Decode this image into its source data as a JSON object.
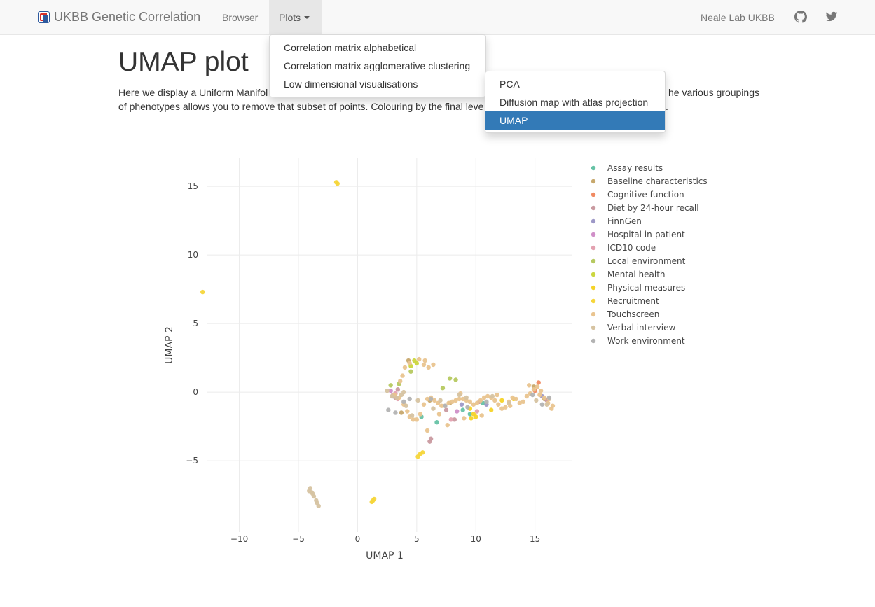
{
  "navbar": {
    "brand": "UKBB Genetic Correlation",
    "browser": "Browser",
    "plots": "Plots",
    "lab": "Neale Lab UKBB"
  },
  "icons": {
    "github": "github-icon",
    "twitter": "twitter-icon"
  },
  "plots_menu": {
    "items": [
      "Correlation matrix alphabetical",
      "Correlation matrix agglomerative clustering",
      "Low dimensional visualisations"
    ]
  },
  "submenu": {
    "items": [
      "PCA",
      "Diffusion map with atlas projection",
      "UMAP"
    ],
    "selected": "UMAP"
  },
  "page": {
    "title": "UMAP plot",
    "intro_line1_start": "Here we display a Uniform Manifol",
    "intro_line1_end": "he various groupings",
    "intro_line2_start": "of phenotypes allows you to remove that subset of points. Colouring by the final leve",
    "intro_line2_end": "."
  },
  "colors": {
    "accent": "#337ab7",
    "navbar_bg": "#f8f8f8"
  },
  "chart_data": {
    "type": "scatter",
    "xlabel": "UMAP 1",
    "ylabel": "UMAP 2",
    "xlim": [
      -12.7,
      18.1
    ],
    "ylim": [
      -10.2,
      17.1
    ],
    "xticks": [
      -10,
      -5,
      0,
      5,
      10,
      15
    ],
    "yticks": [
      -5,
      0,
      5,
      10,
      15
    ],
    "xtick_labels": [
      "−10",
      "−5",
      "0",
      "5",
      "10",
      "15"
    ],
    "ytick_labels": [
      "−5",
      "0",
      "5",
      "10",
      "15"
    ],
    "grid": true,
    "legend_position": "right",
    "series": [
      {
        "name": "Assay results",
        "color": "#66c2a5",
        "x": [
          5.4,
          6.7,
          8.9,
          9.5,
          10.6
        ],
        "y": [
          -1.8,
          -2.2,
          -1.3,
          -1.6,
          -0.8
        ]
      },
      {
        "name": "Baseline characteristics",
        "color": "#c7a86d",
        "x": [
          3.7,
          4.3,
          6.1,
          7.8,
          14.9,
          15.8
        ],
        "y": [
          -1.5,
          2.3,
          -0.6,
          -0.8,
          0.4,
          -0.5
        ]
      },
      {
        "name": "Cognitive function",
        "color": "#f08a62",
        "x": [
          15.3,
          15.0
        ],
        "y": [
          0.7,
          0.1
        ]
      },
      {
        "name": "Diet by 24-hour recall",
        "color": "#c99aa0",
        "x": [
          3.2,
          3.4,
          7.5,
          8.2,
          10.3,
          16.0,
          6.1,
          6.2
        ],
        "y": [
          -0.4,
          0.2,
          -1.3,
          -2.0,
          -0.7,
          -0.6,
          -3.6,
          -3.4
        ]
      },
      {
        "name": "FinnGen",
        "color": "#9d98c7",
        "x": [
          3.0,
          8.8,
          10.9,
          15.6
        ],
        "y": [
          -0.3,
          -0.9,
          -0.9,
          -0.3
        ]
      },
      {
        "name": "Hospital in-patient",
        "color": "#d08fc8",
        "x": [
          3.0,
          2.8,
          8.4
        ],
        "y": [
          -0.2,
          0.1,
          -1.4
        ]
      },
      {
        "name": "ICD10 code",
        "color": "#e3a1b0",
        "x": [
          3.4,
          3.2,
          7.9,
          10.1
        ],
        "y": [
          -0.5,
          -0.1,
          -2.0,
          -1.4
        ]
      },
      {
        "name": "Local environment",
        "color": "#b6c960",
        "x": [
          7.2,
          7.8,
          8.3,
          2.8,
          3.5,
          4.5
        ],
        "y": [
          0.3,
          1.0,
          0.9,
          0.5,
          0.6,
          1.5
        ]
      },
      {
        "name": "Mental health",
        "color": "#cbd63f",
        "x": [
          4.5,
          5.0,
          4.8
        ],
        "y": [
          1.9,
          2.1,
          2.3
        ]
      },
      {
        "name": "Physical measures",
        "color": "#f5d328",
        "x": [
          9.8,
          9.6,
          10.0,
          12.2,
          13.2,
          9.5,
          11.3
        ],
        "y": [
          -1.6,
          -1.9,
          -1.8,
          -0.6,
          -0.5,
          -1.2,
          -1.3
        ]
      },
      {
        "name": "Recruitment",
        "color": "#f6d63b",
        "x": [
          -1.8,
          -1.7,
          -13.1,
          5.1,
          5.3,
          5.5,
          1.2,
          1.3,
          1.4
        ],
        "y": [
          15.3,
          15.2,
          7.3,
          -4.7,
          -4.5,
          -4.4,
          -8.0,
          -7.9,
          -7.8
        ]
      },
      {
        "name": "Touchscreen",
        "color": "#e9c48f",
        "x": [
          3.1,
          3.5,
          3.9,
          4.2,
          4.4,
          4.7,
          5.0,
          5.3,
          5.6,
          5.9,
          6.2,
          6.5,
          6.8,
          7.1,
          7.4,
          7.7,
          8.0,
          8.3,
          8.6,
          8.9,
          9.2,
          9.5,
          9.8,
          10.1,
          10.4,
          10.7,
          11.0,
          11.3,
          11.6,
          11.9,
          12.2,
          12.5,
          12.8,
          13.1,
          13.4,
          13.7,
          14.0,
          14.3,
          14.6,
          14.9,
          15.2,
          15.5,
          15.8,
          16.1,
          16.4,
          3.8,
          4.0,
          4.4,
          5.2,
          5.6,
          6.0,
          6.4,
          5.7,
          6.9,
          7.6,
          9.0,
          10.5,
          11.8,
          12.9,
          14.5,
          15.4,
          16.2,
          16.5,
          3.6,
          5.9,
          8.7
        ],
        "y": [
          -0.2,
          -0.4,
          -0.9,
          -1.4,
          -1.8,
          -2.0,
          -2.0,
          -1.6,
          -0.9,
          -0.5,
          -0.4,
          -0.6,
          -0.8,
          -1.0,
          -1.0,
          -0.8,
          -0.7,
          -0.6,
          -0.5,
          -0.5,
          -0.6,
          -0.7,
          -0.9,
          -0.8,
          -0.6,
          -0.4,
          -0.3,
          -0.4,
          -0.6,
          -0.9,
          -1.2,
          -1.1,
          -0.7,
          -0.4,
          -0.5,
          -0.8,
          -0.7,
          -0.3,
          -0.1,
          0.2,
          0.4,
          0.1,
          -0.4,
          -0.8,
          -1.2,
          1.2,
          1.8,
          2.1,
          2.4,
          2.0,
          1.8,
          2.0,
          2.3,
          -1.6,
          -2.4,
          -1.9,
          -1.7,
          -0.2,
          -1.0,
          0.5,
          -0.2,
          -0.5,
          -1.0,
          0.8,
          -2.8,
          -0.1
        ]
      },
      {
        "name": "Verbal interview",
        "color": "#d6c3a1",
        "x": [
          2.5,
          2.9,
          3.3,
          3.7,
          3.9,
          4.1,
          4.6,
          5.1,
          6.4,
          7.0,
          8.6,
          9.2,
          11.4,
          12.8,
          15.1,
          16.0,
          -4.0,
          -3.9,
          -3.7,
          -3.5,
          -3.4,
          -3.3,
          -4.1,
          -3.8
        ],
        "y": [
          0.1,
          -0.3,
          -0.4,
          -0.2,
          0.0,
          -1.0,
          -1.7,
          -0.6,
          -1.2,
          -0.6,
          -0.2,
          -0.4,
          -0.3,
          -0.8,
          -0.6,
          -0.9,
          -7.0,
          -7.3,
          -7.6,
          -7.9,
          -8.1,
          -8.3,
          -7.2,
          -7.4
        ]
      },
      {
        "name": "Work environment",
        "color": "#b3b3b3",
        "x": [
          2.6,
          3.2,
          3.9,
          4.4,
          6.2,
          7.4,
          9.3,
          10.9,
          14.8,
          16.2,
          15.6
        ],
        "y": [
          -1.3,
          -1.5,
          -0.7,
          -0.5,
          -0.5,
          -1.0,
          -1.1,
          -0.7,
          -0.2,
          -0.4,
          -0.9
        ]
      }
    ]
  }
}
